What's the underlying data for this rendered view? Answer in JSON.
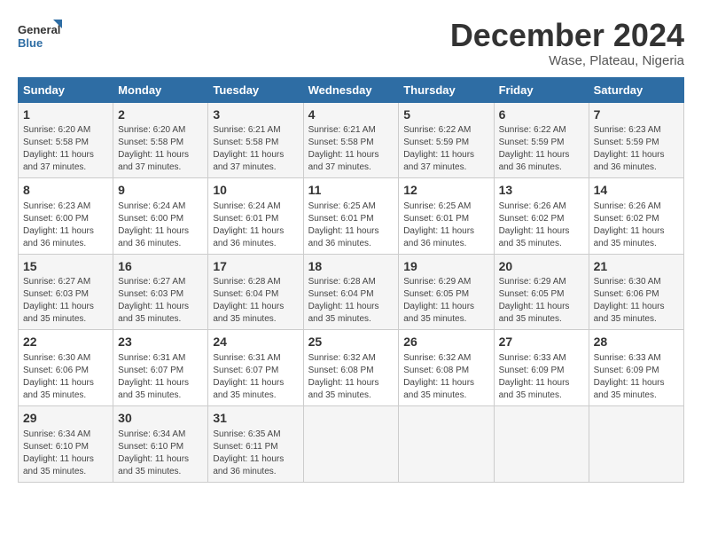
{
  "header": {
    "logo_line1": "General",
    "logo_line2": "Blue",
    "month": "December 2024",
    "location": "Wase, Plateau, Nigeria"
  },
  "days_of_week": [
    "Sunday",
    "Monday",
    "Tuesday",
    "Wednesday",
    "Thursday",
    "Friday",
    "Saturday"
  ],
  "weeks": [
    [
      {
        "day": "1",
        "info": "Sunrise: 6:20 AM\nSunset: 5:58 PM\nDaylight: 11 hours\nand 37 minutes."
      },
      {
        "day": "2",
        "info": "Sunrise: 6:20 AM\nSunset: 5:58 PM\nDaylight: 11 hours\nand 37 minutes."
      },
      {
        "day": "3",
        "info": "Sunrise: 6:21 AM\nSunset: 5:58 PM\nDaylight: 11 hours\nand 37 minutes."
      },
      {
        "day": "4",
        "info": "Sunrise: 6:21 AM\nSunset: 5:58 PM\nDaylight: 11 hours\nand 37 minutes."
      },
      {
        "day": "5",
        "info": "Sunrise: 6:22 AM\nSunset: 5:59 PM\nDaylight: 11 hours\nand 37 minutes."
      },
      {
        "day": "6",
        "info": "Sunrise: 6:22 AM\nSunset: 5:59 PM\nDaylight: 11 hours\nand 36 minutes."
      },
      {
        "day": "7",
        "info": "Sunrise: 6:23 AM\nSunset: 5:59 PM\nDaylight: 11 hours\nand 36 minutes."
      }
    ],
    [
      {
        "day": "8",
        "info": "Sunrise: 6:23 AM\nSunset: 6:00 PM\nDaylight: 11 hours\nand 36 minutes."
      },
      {
        "day": "9",
        "info": "Sunrise: 6:24 AM\nSunset: 6:00 PM\nDaylight: 11 hours\nand 36 minutes."
      },
      {
        "day": "10",
        "info": "Sunrise: 6:24 AM\nSunset: 6:01 PM\nDaylight: 11 hours\nand 36 minutes."
      },
      {
        "day": "11",
        "info": "Sunrise: 6:25 AM\nSunset: 6:01 PM\nDaylight: 11 hours\nand 36 minutes."
      },
      {
        "day": "12",
        "info": "Sunrise: 6:25 AM\nSunset: 6:01 PM\nDaylight: 11 hours\nand 36 minutes."
      },
      {
        "day": "13",
        "info": "Sunrise: 6:26 AM\nSunset: 6:02 PM\nDaylight: 11 hours\nand 35 minutes."
      },
      {
        "day": "14",
        "info": "Sunrise: 6:26 AM\nSunset: 6:02 PM\nDaylight: 11 hours\nand 35 minutes."
      }
    ],
    [
      {
        "day": "15",
        "info": "Sunrise: 6:27 AM\nSunset: 6:03 PM\nDaylight: 11 hours\nand 35 minutes."
      },
      {
        "day": "16",
        "info": "Sunrise: 6:27 AM\nSunset: 6:03 PM\nDaylight: 11 hours\nand 35 minutes."
      },
      {
        "day": "17",
        "info": "Sunrise: 6:28 AM\nSunset: 6:04 PM\nDaylight: 11 hours\nand 35 minutes."
      },
      {
        "day": "18",
        "info": "Sunrise: 6:28 AM\nSunset: 6:04 PM\nDaylight: 11 hours\nand 35 minutes."
      },
      {
        "day": "19",
        "info": "Sunrise: 6:29 AM\nSunset: 6:05 PM\nDaylight: 11 hours\nand 35 minutes."
      },
      {
        "day": "20",
        "info": "Sunrise: 6:29 AM\nSunset: 6:05 PM\nDaylight: 11 hours\nand 35 minutes."
      },
      {
        "day": "21",
        "info": "Sunrise: 6:30 AM\nSunset: 6:06 PM\nDaylight: 11 hours\nand 35 minutes."
      }
    ],
    [
      {
        "day": "22",
        "info": "Sunrise: 6:30 AM\nSunset: 6:06 PM\nDaylight: 11 hours\nand 35 minutes."
      },
      {
        "day": "23",
        "info": "Sunrise: 6:31 AM\nSunset: 6:07 PM\nDaylight: 11 hours\nand 35 minutes."
      },
      {
        "day": "24",
        "info": "Sunrise: 6:31 AM\nSunset: 6:07 PM\nDaylight: 11 hours\nand 35 minutes."
      },
      {
        "day": "25",
        "info": "Sunrise: 6:32 AM\nSunset: 6:08 PM\nDaylight: 11 hours\nand 35 minutes."
      },
      {
        "day": "26",
        "info": "Sunrise: 6:32 AM\nSunset: 6:08 PM\nDaylight: 11 hours\nand 35 minutes."
      },
      {
        "day": "27",
        "info": "Sunrise: 6:33 AM\nSunset: 6:09 PM\nDaylight: 11 hours\nand 35 minutes."
      },
      {
        "day": "28",
        "info": "Sunrise: 6:33 AM\nSunset: 6:09 PM\nDaylight: 11 hours\nand 35 minutes."
      }
    ],
    [
      {
        "day": "29",
        "info": "Sunrise: 6:34 AM\nSunset: 6:10 PM\nDaylight: 11 hours\nand 35 minutes."
      },
      {
        "day": "30",
        "info": "Sunrise: 6:34 AM\nSunset: 6:10 PM\nDaylight: 11 hours\nand 35 minutes."
      },
      {
        "day": "31",
        "info": "Sunrise: 6:35 AM\nSunset: 6:11 PM\nDaylight: 11 hours\nand 36 minutes."
      },
      {
        "day": "",
        "info": ""
      },
      {
        "day": "",
        "info": ""
      },
      {
        "day": "",
        "info": ""
      },
      {
        "day": "",
        "info": ""
      }
    ]
  ]
}
